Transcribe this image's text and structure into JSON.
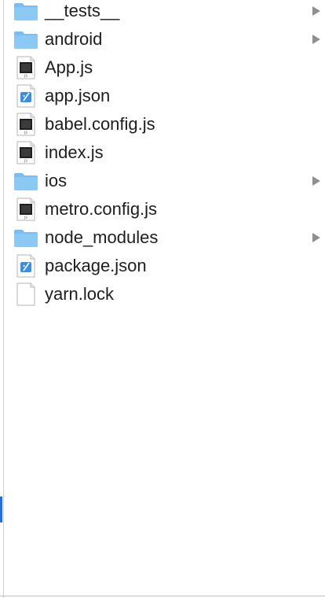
{
  "file_browser": {
    "items": [
      {
        "name": "__tests__",
        "kind": "folder",
        "expandable": true
      },
      {
        "name": "android",
        "kind": "folder",
        "expandable": true
      },
      {
        "name": "App.js",
        "kind": "js",
        "expandable": false
      },
      {
        "name": "app.json",
        "kind": "json",
        "expandable": false
      },
      {
        "name": "babel.config.js",
        "kind": "js",
        "expandable": false
      },
      {
        "name": "index.js",
        "kind": "js",
        "expandable": false
      },
      {
        "name": "ios",
        "kind": "folder",
        "expandable": true
      },
      {
        "name": "metro.config.js",
        "kind": "js",
        "expandable": false
      },
      {
        "name": "node_modules",
        "kind": "folder",
        "expandable": true
      },
      {
        "name": "package.json",
        "kind": "json",
        "expandable": false
      },
      {
        "name": "yarn.lock",
        "kind": "file",
        "expandable": false
      }
    ]
  },
  "icons": {
    "folder": "folder-icon",
    "js": "javascript-file-icon",
    "json": "json-file-icon",
    "file": "blank-file-icon",
    "arrow": "disclosure-arrow-icon",
    "js_badge_text": "JS"
  },
  "colors": {
    "folder_body": "#8cc8f4",
    "folder_tab": "#7bbdf0",
    "text": "#1d1d1d",
    "arrow": "#8e8e8e",
    "scroll_indicator": "#1f6fe0"
  }
}
